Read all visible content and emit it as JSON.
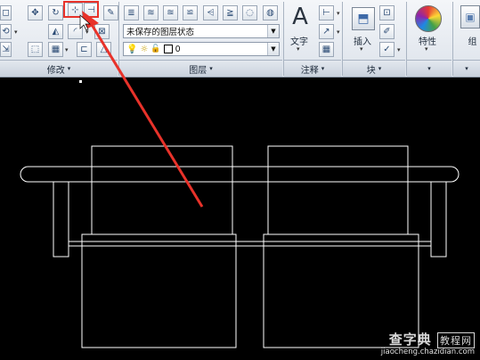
{
  "ribbon": {
    "panels": {
      "modify": "修改",
      "layers": "图层",
      "annotation": "注释",
      "block": "块",
      "group": "组"
    },
    "layer_state_value": "未保存的图层状态",
    "layer_value": "0",
    "text_button_label": "文字",
    "insert_button_label": "插入",
    "properties_button_label": "特性",
    "group_button_label": "组",
    "expand_arrow": "▾"
  },
  "watermark": {
    "brand": "查字典",
    "brand_box": "教程网",
    "url": "jiaocheng.chazidian.com"
  },
  "colors": {
    "canvas_background": "#000000",
    "drawing_lines": "#ffffff",
    "annotation_red": "#e8322a",
    "ribbon_background": "#e6ebf1"
  },
  "icons": [
    "move-icon",
    "rotate-icon",
    "mirror-icon",
    "fillet-icon",
    "stretch-icon",
    "scale-icon",
    "array-icon",
    "erase-icon",
    "copy-icon",
    "trim-icon",
    "explode-icon",
    "offset-icon",
    "layer-properties-icon",
    "layer-state-icon",
    "text-icon",
    "dimension-icon",
    "leader-icon",
    "table-icon",
    "insert-block-icon",
    "create-block-icon",
    "edit-block-icon",
    "color-wheel-icon",
    "group-icon",
    "bulb-icon",
    "sun-icon",
    "lock-icon"
  ]
}
